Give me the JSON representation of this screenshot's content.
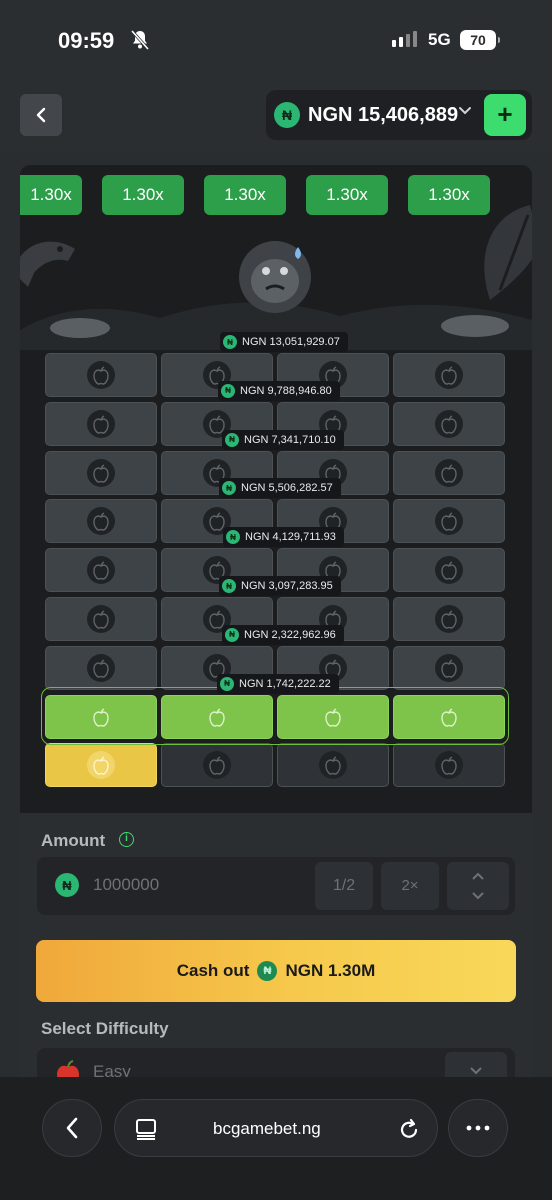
{
  "status": {
    "time": "09:59",
    "network": "5G",
    "battery": "70"
  },
  "header": {
    "currency_symbol": "₦",
    "balance": "NGN 15,406,889",
    "add_label": "+"
  },
  "game": {
    "multipliers": [
      "1.30x",
      "1.30x",
      "1.30x",
      "1.30x",
      "1.30x"
    ],
    "prizes": [
      "NGN 13,051,929.07",
      "NGN 9,788,946.80",
      "NGN 7,341,710.10",
      "NGN 5,506,282.57",
      "NGN 4,129,711.93",
      "NGN 3,097,283.95",
      "NGN 2,322,962.96",
      "NGN 1,742,222.22"
    ],
    "coin_symbol": "₦"
  },
  "controls": {
    "amount_label": "Amount",
    "info_symbol": "i",
    "amount_value": "1000000",
    "half_label": "1/2",
    "double_label": "2×",
    "cashout_prefix": "Cash out",
    "cashout_value": "NGN 1.30M",
    "difficulty_label": "Select Difficulty",
    "difficulty_value": "Easy"
  },
  "browser": {
    "url": "bcgamebet.ng"
  },
  "colors": {
    "accent_green": "#3ddc6e",
    "tile_green": "#7ec34a",
    "cashout_gold": "#f6c94c"
  }
}
